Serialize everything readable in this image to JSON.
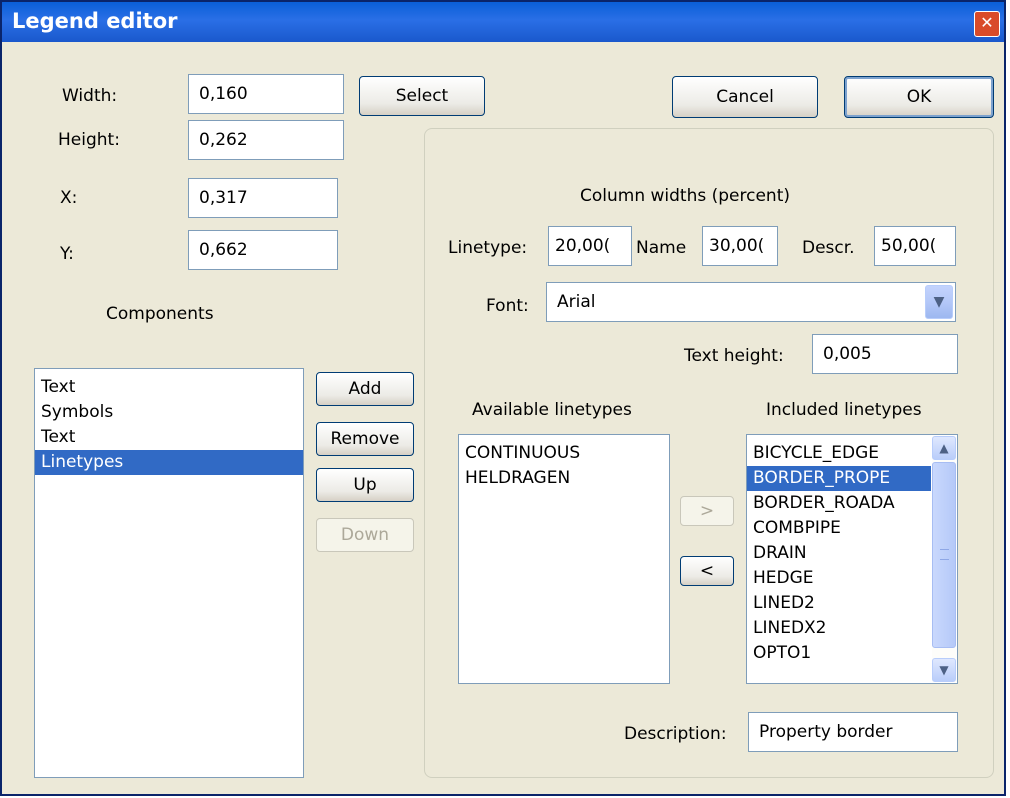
{
  "window": {
    "title": "Legend editor",
    "close_glyph": "✕"
  },
  "fields": {
    "width_label": "Width:",
    "width_value": "0,160",
    "height_label": "Height:",
    "height_value": "0,262",
    "x_label": "X:",
    "x_value": "0,317",
    "y_label": "Y:",
    "y_value": "0,662"
  },
  "buttons": {
    "select": "Select",
    "cancel": "Cancel",
    "ok": "OK",
    "add": "Add",
    "remove": "Remove",
    "up": "Up",
    "down": "Down",
    "move_right": ">",
    "move_left": "<"
  },
  "components": {
    "heading": "Components",
    "items": [
      "Text",
      "Symbols",
      "Text",
      "Linetypes"
    ],
    "selected_index": 3
  },
  "columns": {
    "heading": "Column widths (percent)",
    "linetype_label": "Linetype:",
    "linetype_value": "20,00(",
    "name_label": "Name",
    "name_value": "30,00(",
    "descr_label": "Descr.",
    "descr_value": "50,00("
  },
  "font": {
    "label": "Font:",
    "value": "Arial"
  },
  "text_height": {
    "label": "Text height:",
    "value": "0,005"
  },
  "available": {
    "heading": "Available linetypes",
    "items": [
      "CONTINUOUS",
      "HELDRAGEN"
    ]
  },
  "included": {
    "heading": "Included linetypes",
    "items": [
      "BICYCLE_EDGE",
      "BORDER_PROPE",
      "BORDER_ROADA",
      "COMBPIPE",
      "DRAIN",
      "HEDGE",
      "LINED2",
      "LINEDX2",
      "OPTO1"
    ],
    "selected_index": 1
  },
  "description": {
    "label": "Description:",
    "value": "Property border"
  },
  "icons": {
    "combo_arrow": "chevron-down-icon",
    "scroll_up": "scroll-up-icon",
    "scroll_down": "scroll-down-icon"
  },
  "colors": {
    "titlebar": "#0A5FD8",
    "selection": "#316AC5",
    "dialog_bg": "#ECE9D8"
  }
}
